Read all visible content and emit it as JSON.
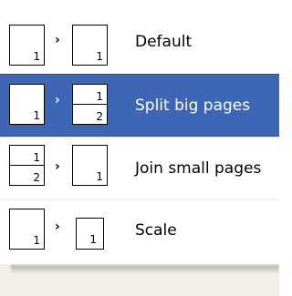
{
  "menu": {
    "items": [
      {
        "label": "Default",
        "from": {
          "type": "single",
          "pages": [
            "1"
          ]
        },
        "to": {
          "type": "single",
          "pages": [
            "1"
          ]
        },
        "selected": false
      },
      {
        "label": "Split big pages",
        "from": {
          "type": "single",
          "pages": [
            "1"
          ]
        },
        "to": {
          "type": "split",
          "pages": [
            "1",
            "2"
          ]
        },
        "selected": true
      },
      {
        "label": "Join small pages",
        "from": {
          "type": "split",
          "pages": [
            "1",
            "2"
          ]
        },
        "to": {
          "type": "single",
          "pages": [
            "1"
          ]
        },
        "selected": false
      },
      {
        "label": "Scale",
        "from": {
          "type": "single",
          "pages": [
            "1"
          ]
        },
        "to": {
          "type": "single-small",
          "pages": [
            "1"
          ]
        },
        "selected": false
      }
    ],
    "colors": {
      "selected_background": "#3d67b5",
      "selected_text": "#ffffff",
      "text": "#000000",
      "background": "#ffffff",
      "bottom_panel": "#f1efe7"
    },
    "arrow_glyph": "›"
  }
}
